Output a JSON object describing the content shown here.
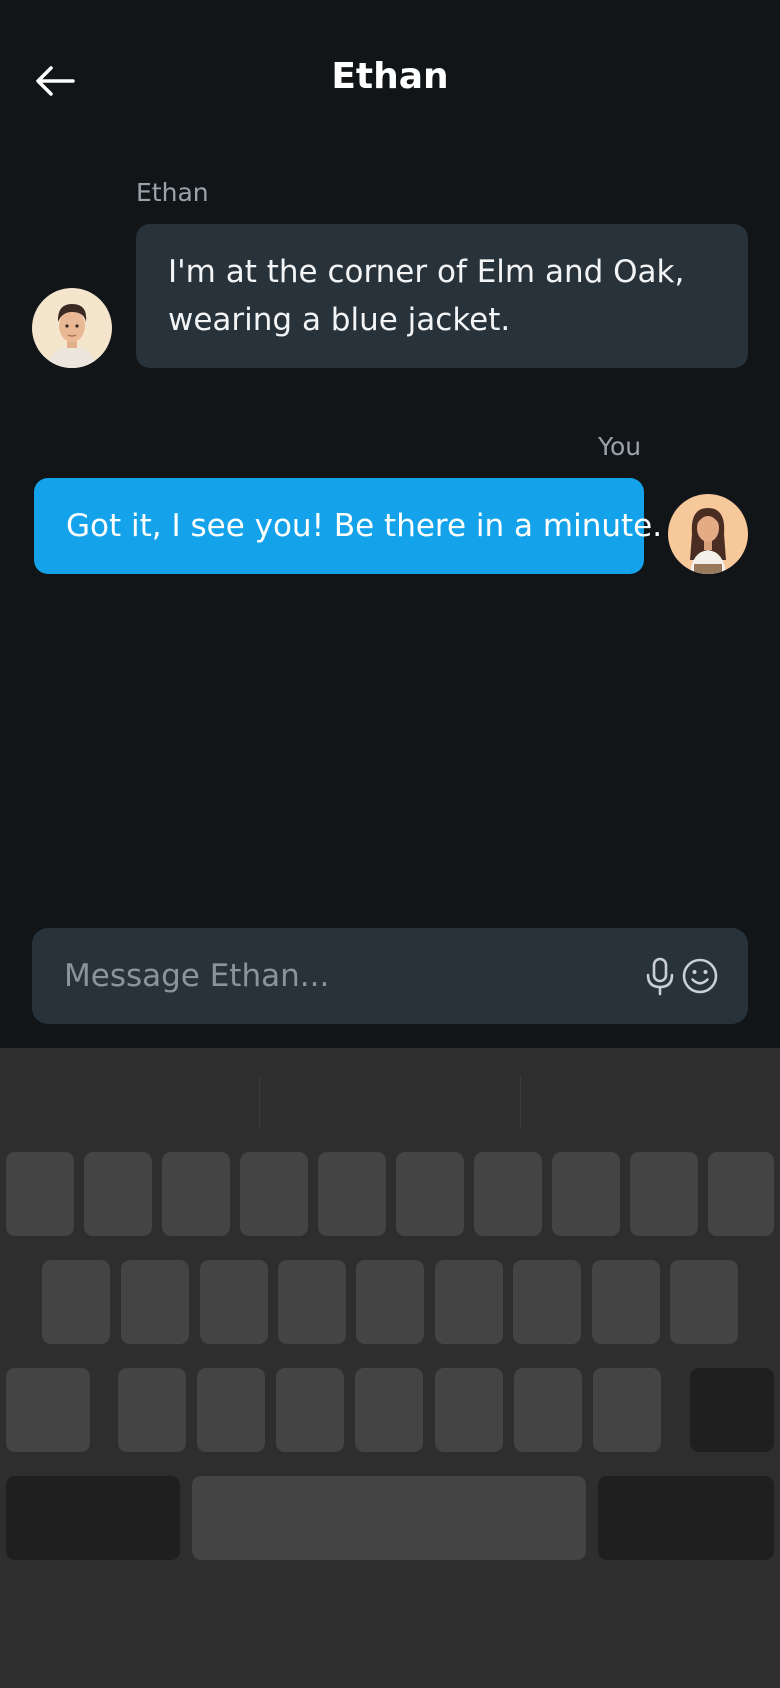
{
  "header": {
    "title": "Ethan",
    "back_icon": "arrow-left-icon"
  },
  "messages": [
    {
      "sender": "Ethan",
      "direction": "incoming",
      "lines": [
        "I'm at the corner of Elm and Oak,",
        "wearing a blue jacket."
      ],
      "avatar": "male-avatar"
    },
    {
      "sender": "You",
      "direction": "outgoing",
      "text": "Got it, I see you! Be there in a minute.",
      "avatar": "female-avatar"
    }
  ],
  "composer": {
    "placeholder": "Message Ethan...",
    "value": "",
    "mic_icon": "microphone-icon",
    "emoji_icon": "smiley-icon"
  },
  "colors": {
    "background": "#111518",
    "incoming_bubble": "#28323a",
    "outgoing_bubble": "#14a3ea",
    "keyboard": "#2e2e2e",
    "key": "#444444"
  }
}
